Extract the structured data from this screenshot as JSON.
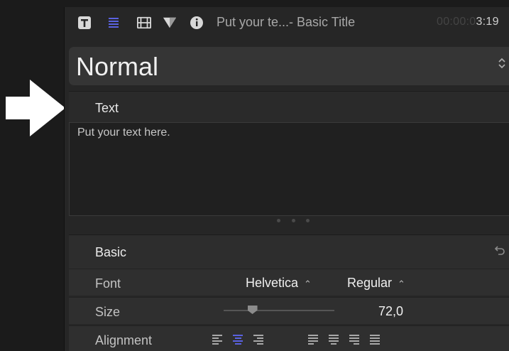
{
  "header": {
    "clip_title": "Put your te...- Basic Title",
    "timecode_dim": "00:00:0",
    "timecode_bright": "3:19",
    "icons": [
      "text-inspector-icon",
      "paragraph-icon",
      "film-icon",
      "triangle-icon",
      "info-icon"
    ],
    "accent_color": "#5a62e0"
  },
  "preset": {
    "value": "Normal",
    "chevron": "⌃⌄"
  },
  "text_section": {
    "label": "Text",
    "content": "Put your text here."
  },
  "basic_section": {
    "label": "Basic",
    "reset_icon": "↶",
    "rows": {
      "font": {
        "label": "Font",
        "family": "Helvetica",
        "style": "Regular",
        "chevron": "⌃"
      },
      "size": {
        "label": "Size",
        "value": "72,0",
        "slider_fraction": 0.26
      },
      "alignment": {
        "label": "Alignment",
        "selected": "center"
      }
    }
  }
}
